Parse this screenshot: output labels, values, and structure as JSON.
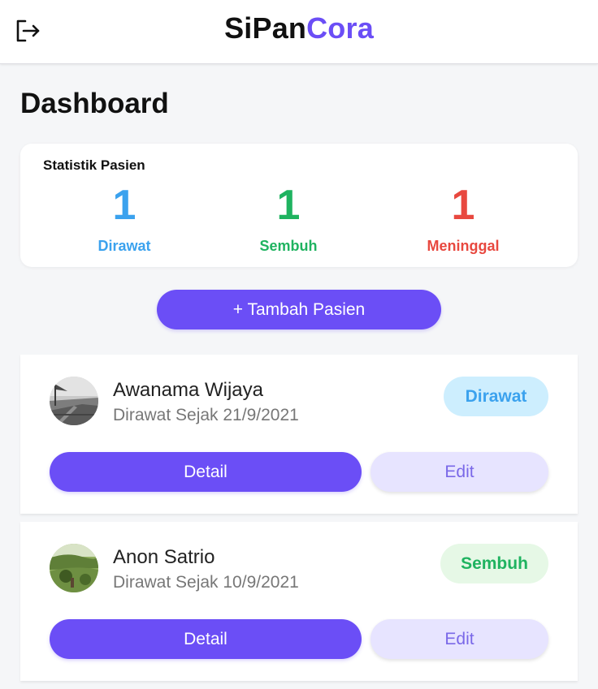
{
  "header": {
    "brand_part1": "SiPan",
    "brand_part2": "Cora",
    "logout_icon": "logout-icon"
  },
  "page": {
    "title": "Dashboard"
  },
  "stats": {
    "title": "Statistik Pasien",
    "items": [
      {
        "value": "1",
        "label": "Dirawat",
        "color": "#3ba2ee"
      },
      {
        "value": "1",
        "label": "Sembuh",
        "color": "#1fb360"
      },
      {
        "value": "1",
        "label": "Meninggal",
        "color": "#e8483f"
      }
    ]
  },
  "add_button": {
    "label": "+ Tambah Pasien"
  },
  "patients": [
    {
      "name": "Awanama Wijaya",
      "since": "Dirawat Sejak 21/9/2021",
      "status": "Dirawat",
      "detail_label": "Detail",
      "edit_label": "Edit"
    },
    {
      "name": "Anon Satrio",
      "since": "Dirawat Sejak 10/9/2021",
      "status": "Sembuh",
      "detail_label": "Detail",
      "edit_label": "Edit"
    }
  ],
  "colors": {
    "accent": "#6b4ef6",
    "dirawat": "#3ba2ee",
    "sembuh": "#1fb360",
    "meninggal": "#e8483f"
  }
}
